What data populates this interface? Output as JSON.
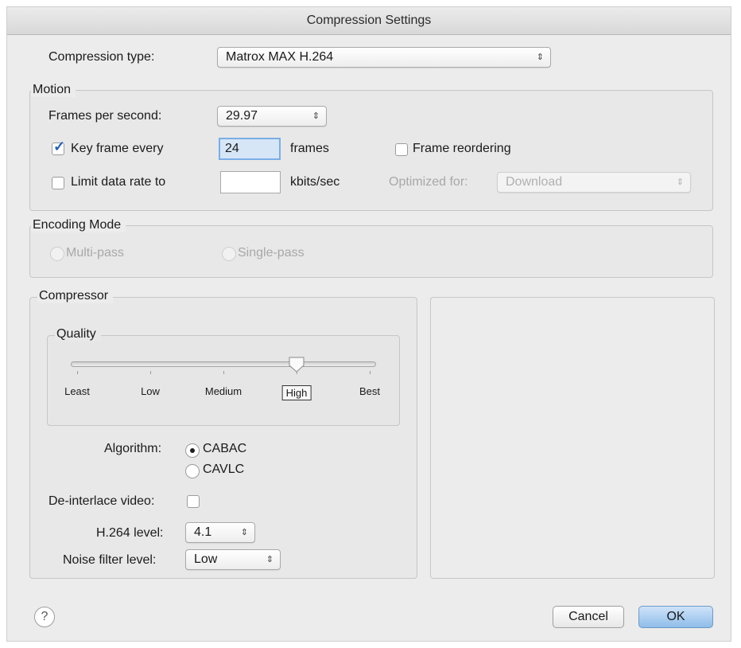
{
  "window": {
    "title": "Compression Settings"
  },
  "compression_type": {
    "label": "Compression type:",
    "value": "Matrox MAX H.264"
  },
  "motion": {
    "title": "Motion",
    "fps_label": "Frames per second:",
    "fps_value": "29.97",
    "key_frame_label": "Key frame every",
    "key_frame_checked": true,
    "key_frame_value": "24",
    "key_frame_unit": "frames",
    "frame_reordering_label": "Frame reordering",
    "frame_reordering_checked": false,
    "limit_data_rate_label": "Limit data rate to",
    "limit_data_rate_checked": false,
    "limit_data_rate_value": "",
    "limit_data_rate_unit": "kbits/sec",
    "optimized_for_label": "Optimized for:",
    "optimized_for_value": "Download"
  },
  "encoding_mode": {
    "title": "Encoding Mode",
    "multi_pass_label": "Multi-pass",
    "single_pass_label": "Single-pass"
  },
  "compressor": {
    "title": "Compressor",
    "quality": {
      "title": "Quality",
      "ticks": [
        "Least",
        "Low",
        "Medium",
        "High",
        "Best"
      ],
      "selected": "High",
      "level": 0.75
    },
    "algorithm_label": "Algorithm:",
    "algorithm_options": [
      "CABAC",
      "CAVLC"
    ],
    "algorithm_selected": "CABAC",
    "deinterlace_label": "De-interlace video:",
    "deinterlace_checked": false,
    "h264_level_label": "H.264 level:",
    "h264_level_value": "4.1",
    "noise_filter_label": "Noise filter level:",
    "noise_filter_value": "Low"
  },
  "buttons": {
    "help": "?",
    "cancel": "Cancel",
    "ok": "OK"
  },
  "icons": {
    "popup_arrows": "⇕",
    "checkmark": "✓"
  }
}
